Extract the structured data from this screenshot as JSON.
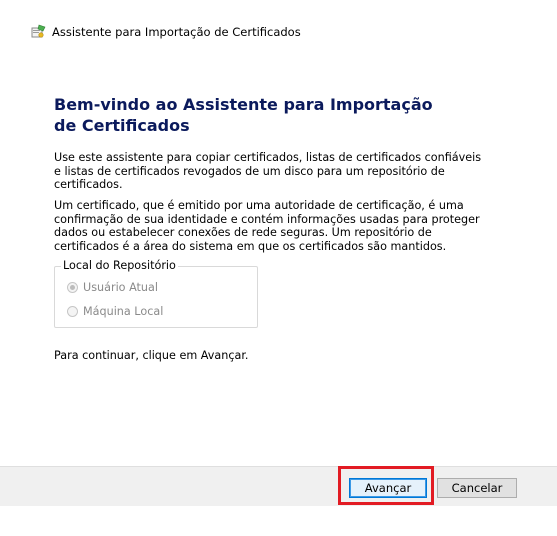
{
  "window": {
    "title": "Assistente para Importação de Certificados",
    "icon": "certificate-import-icon"
  },
  "main": {
    "heading": "Bem-vindo ao Assistente para Importação de Certificados",
    "intro": "Use este assistente para copiar certificados, listas de certificados confiáveis e listas de certificados revogados de um disco para um repositório de certificados.",
    "description": "Um certificado, que é emitido por uma autoridade de certificação, é uma confirmação de sua identidade e contém informações usadas para proteger dados ou estabelecer conexões de rede seguras. Um repositório de certificados é a área do sistema em que os certificados são mantidos.",
    "store_location": {
      "legend": "Local do Repositório",
      "options": [
        {
          "label": "Usuário Atual",
          "selected": true,
          "enabled": false
        },
        {
          "label": "Máquina Local",
          "selected": false,
          "enabled": false
        }
      ]
    },
    "continue_text": "Para continuar, clique em Avançar."
  },
  "footer": {
    "next_label": "Avançar",
    "cancel_label": "Cancelar"
  },
  "colors": {
    "heading": "#0b1a5c",
    "highlight": "#e21b23",
    "footer_bg": "#f0f0f0",
    "button_focus_border": "#0078d7"
  }
}
